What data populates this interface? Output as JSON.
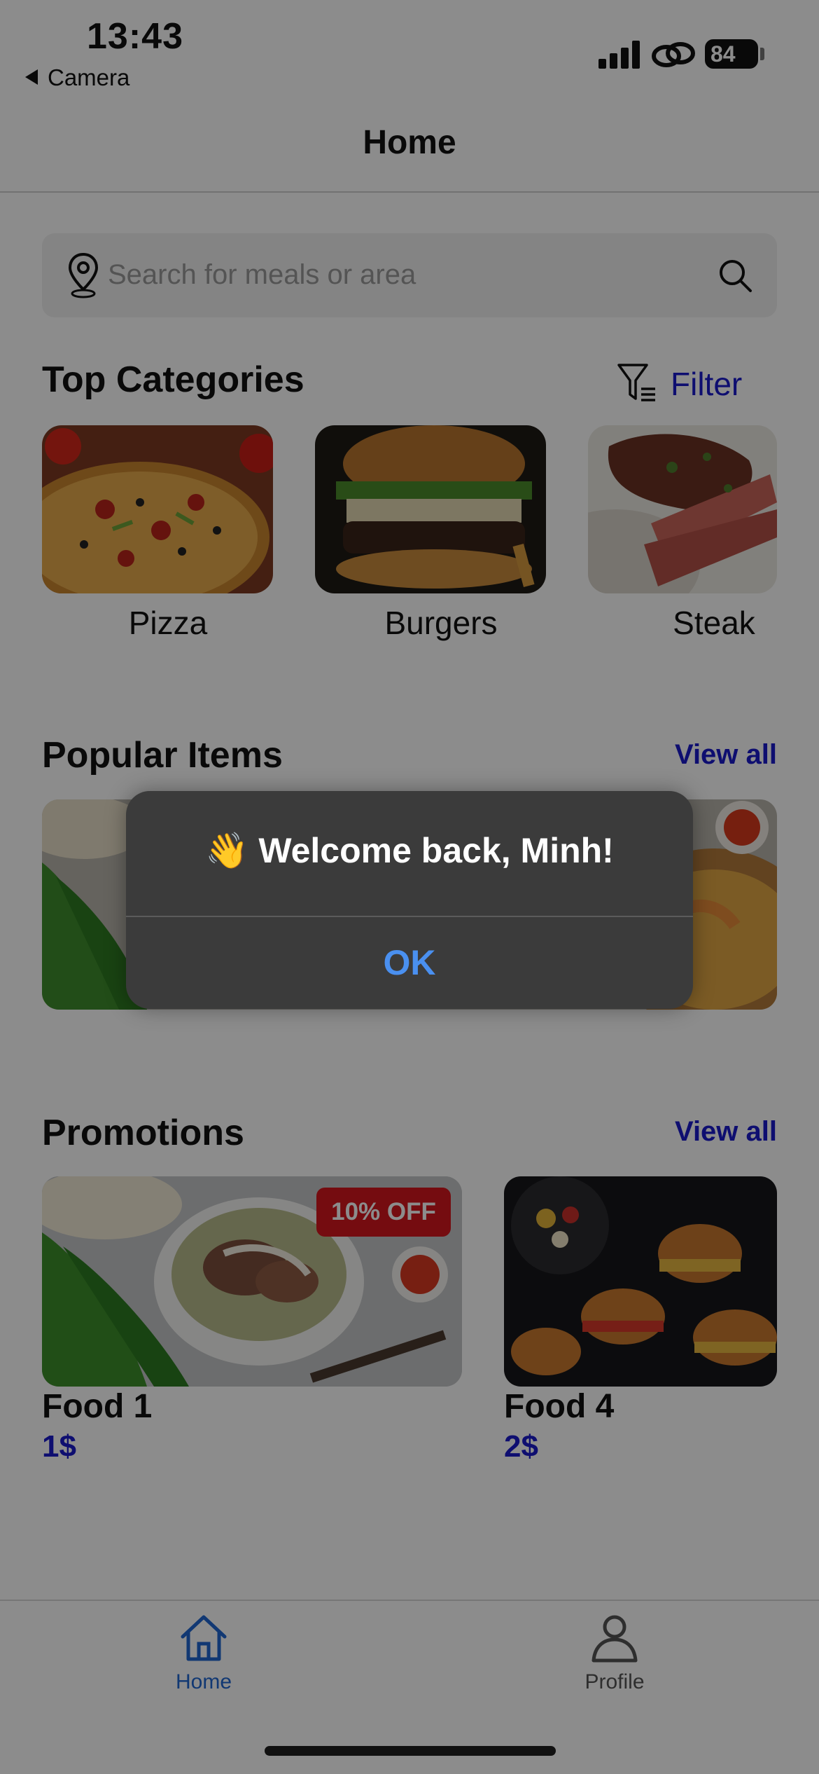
{
  "status_bar": {
    "time": "13:43",
    "back_label": "Camera",
    "battery": "84"
  },
  "nav": {
    "title": "Home"
  },
  "search": {
    "placeholder": "Search for meals or area"
  },
  "categories": {
    "title": "Top Categories",
    "filter_label": "Filter",
    "items": [
      {
        "label": "Pizza"
      },
      {
        "label": "Burgers"
      },
      {
        "label": "Steak"
      }
    ]
  },
  "popular": {
    "title": "Popular Items",
    "view_all": "View all"
  },
  "promotions": {
    "title": "Promotions",
    "view_all": "View all",
    "items": [
      {
        "name": "Food 1",
        "price": "1$",
        "badge": "10% OFF"
      },
      {
        "name": "Food 4",
        "price": "2$"
      }
    ]
  },
  "tabbar": {
    "items": [
      {
        "label": "Home",
        "icon": "home-icon",
        "active": true
      },
      {
        "label": "Profile",
        "icon": "person-icon",
        "active": false
      }
    ]
  },
  "alert": {
    "emoji": "👋",
    "message": "Welcome back, Minh!",
    "ok": "OK"
  },
  "colors": {
    "accent": "#1a1acc",
    "tab_active": "#1f66d1",
    "discount": "#d6171e",
    "alert_ok": "#4a90f0"
  }
}
